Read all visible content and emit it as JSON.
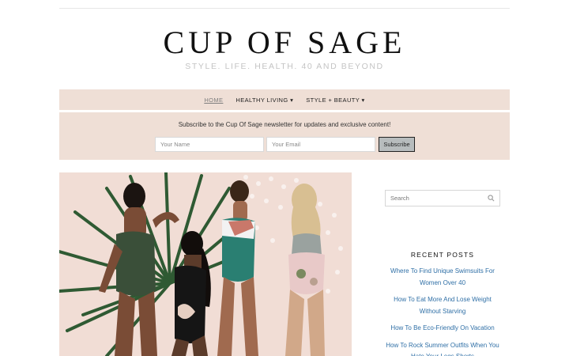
{
  "site": {
    "title": "CUP OF SAGE",
    "tagline": "STYLE. LIFE. HEALTH. 40 AND BEYOND"
  },
  "nav": {
    "items": [
      {
        "label": "HOME",
        "active": true
      },
      {
        "label": "HEALTHY LIVING ▾",
        "active": false
      },
      {
        "label": "STYLE + BEAUTY ▾",
        "active": false
      }
    ]
  },
  "subscribe": {
    "text": "Subscribe to the Cup Of Sage newsletter for updates and exclusive content!",
    "name_placeholder": "Your Name",
    "email_placeholder": "Your Email",
    "button_label": "Subscribe"
  },
  "sidebar": {
    "search_placeholder": "Search",
    "recent_title": "RECENT POSTS",
    "recent_posts": [
      "Where To Find Unique Swimsuits For Women Over 40",
      "How To Eat More And Lose Weight Without Starving",
      "How To Be Eco-Friendly On Vacation",
      "How To Rock Summer Outfits When You Hate Your Legs Shorts"
    ]
  },
  "colors": {
    "accent_bg": "#efdfd6",
    "link": "#2f6fa6",
    "featured_bg": "#f1ddd5"
  },
  "icons": {
    "search": "search-icon",
    "featured": "featured-image"
  }
}
